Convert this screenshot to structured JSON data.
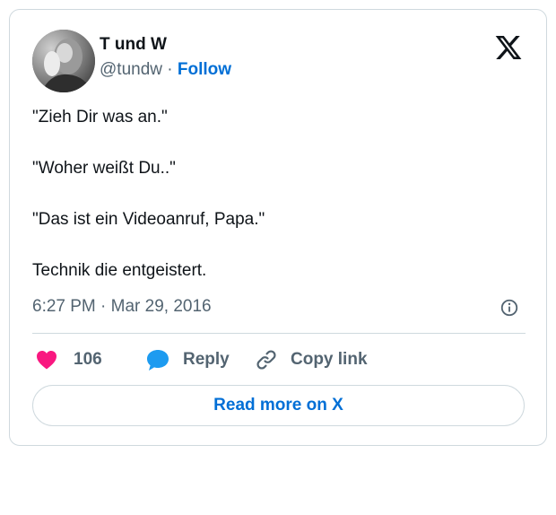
{
  "author": {
    "name": "T und W",
    "handle": "@tundw",
    "separator": "·",
    "follow_label": "Follow"
  },
  "tweet": {
    "lines": [
      "\"Zieh Dir was an.\"",
      "\"Woher weißt Du..\"",
      "\"Das ist ein Videoanruf, Papa.\"",
      "Technik die entgeistert."
    ],
    "timestamp": "6:27 PM · Mar 29, 2016"
  },
  "actions": {
    "likes_count": "106",
    "reply_label": "Reply",
    "copy_link_label": "Copy link"
  },
  "read_more_label": "Read more on X",
  "icons": {
    "logo": "x-logo-icon",
    "like": "heart-icon",
    "reply": "speech-bubble-icon",
    "copy": "link-icon",
    "info": "info-icon"
  },
  "colors": {
    "like": "#f91880",
    "reply": "#1d9bf0",
    "link": "#006fd6",
    "muted": "#536471",
    "border": "#cfd9de"
  }
}
